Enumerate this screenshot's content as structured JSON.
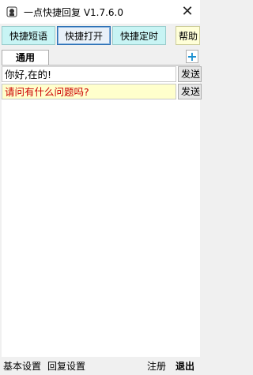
{
  "window": {
    "title": "一点快捷回复 V1.7.6.0",
    "close_glyph": "✕"
  },
  "toolbar": {
    "buttons": [
      {
        "label": "快捷短语",
        "color": "#c8f4f4"
      },
      {
        "label": "快捷打开",
        "color": "#e8f0f8"
      },
      {
        "label": "快捷定时",
        "color": "#c8f4f4"
      },
      {
        "label": "帮助",
        "color": "#ffffd8"
      }
    ]
  },
  "tabs": {
    "items": [
      {
        "label": "通用"
      }
    ],
    "add_glyph": "+"
  },
  "replies": [
    {
      "text": "你好,在的!",
      "send_label": "发送",
      "text_color": "#000000",
      "bg": "#ffffff"
    },
    {
      "text": "请问有什么问题吗?",
      "send_label": "发送",
      "text_color": "#cc0000",
      "bg": "#ffffcc"
    }
  ],
  "footer": {
    "basic_settings": "基本设置",
    "reply_settings": "回复设置",
    "register": "注册",
    "exit": "退出"
  }
}
